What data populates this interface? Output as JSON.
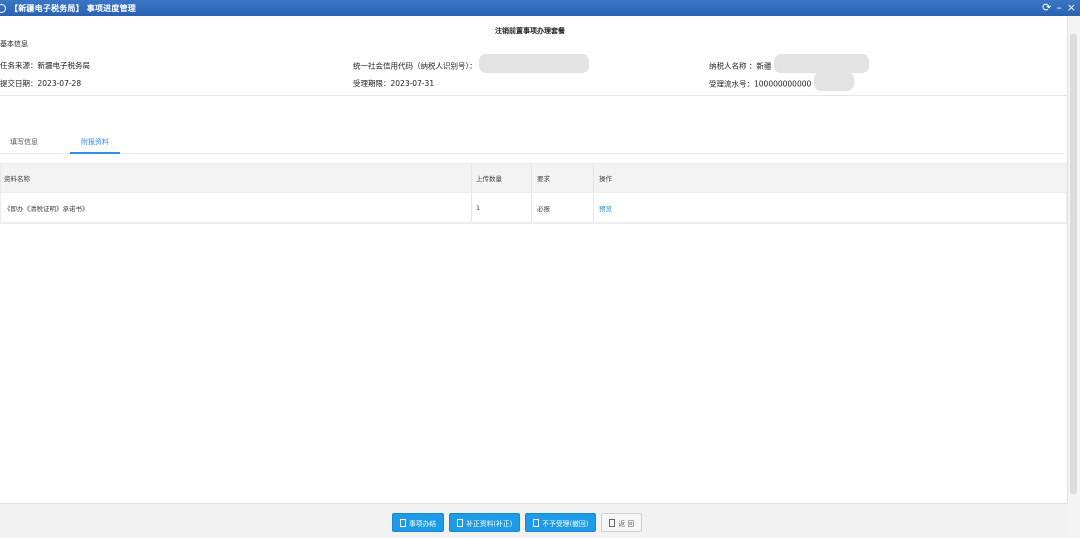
{
  "window": {
    "title": "【新疆电子税务局】 事项进度管理",
    "controls": {
      "refresh": "⟳",
      "minimize": "–",
      "close": "×"
    }
  },
  "page": {
    "title": "注销前置事项办理套餐",
    "section_label": "基本信息"
  },
  "info": {
    "task_source": "任务来源：新疆电子税务局",
    "credit_code_label": "统一社会信用代码（纳税人识别号）：",
    "taxpayer_name_label": "纳税人名称 ：新疆",
    "submit_date": "提交日期：2023-07-28",
    "deadline": "受理期限：2023-07-31",
    "serial_no": "受理流水号：100000000000"
  },
  "tabs": [
    {
      "label": "填写信息",
      "active": false
    },
    {
      "label": "附报资料",
      "active": true
    }
  ],
  "table": {
    "headers": {
      "name": "资料名称",
      "count": "上传数量",
      "req": "要求",
      "op": "操作"
    },
    "rows": [
      {
        "name": "《即办《清税证明》承诺书》",
        "count": "1",
        "req": "必报",
        "op": "预览"
      }
    ]
  },
  "footer": {
    "buttons": [
      {
        "label": "事项办结",
        "style": "primary"
      },
      {
        "label": "补正资料(补正)",
        "style": "primary"
      },
      {
        "label": "不予受理(撤回)",
        "style": "primary"
      },
      {
        "label": "返 回",
        "style": "light"
      }
    ]
  },
  "colors": {
    "titlebar": "#2a62b0",
    "accent": "#2f8ee6",
    "button": "#1d9be6"
  }
}
